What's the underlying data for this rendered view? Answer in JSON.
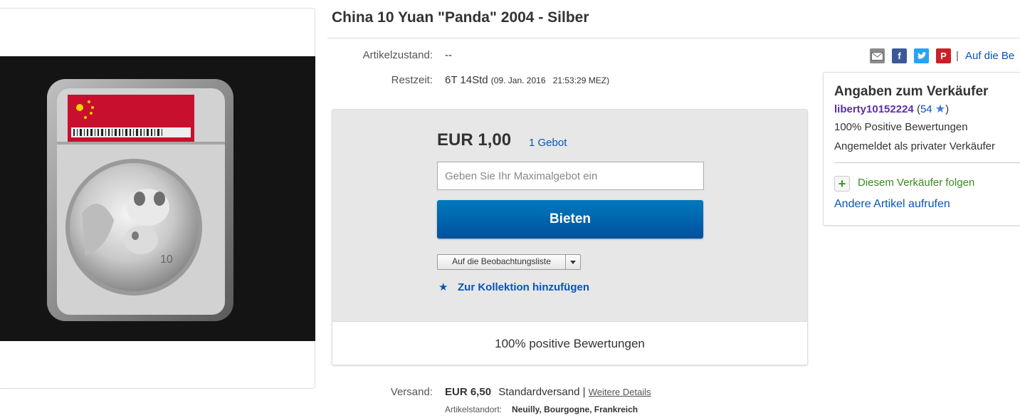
{
  "listing": {
    "title": "China 10 Yuan \"Panda\" 2004 - Silber",
    "condition_label": "Artikelzustand:",
    "condition_value": "--",
    "time_label": "Restzeit:",
    "time_value": "6T 14Std",
    "end_date": "(09. Jan. 2016",
    "end_time": "21:53:29 MEZ)"
  },
  "share": {
    "email_icon": "email-icon",
    "facebook_icon": "facebook-icon",
    "twitter_icon": "twitter-icon",
    "pinterest_icon": "pinterest-icon",
    "separator": "|",
    "watch_link": "Auf die Be"
  },
  "bid": {
    "price": "EUR 1,00",
    "bid_count": "1 Gebot",
    "max_bid_placeholder": "Geben Sie Ihr Maximalgebot ein",
    "bid_button": "Bieten",
    "watchlist": "Auf die Beobachtungsliste",
    "collection": "Zur Kollektion hinzufügen",
    "positive": "100% positive Bewertungen"
  },
  "seller": {
    "heading": "Angaben zum Verkäufer",
    "username": "liberty10152224",
    "open_paren": "(",
    "score": "54",
    "close_paren": ")",
    "positive": "100% Positive Bewertungen",
    "type": "Angemeldet als privater Verkäufer",
    "follow": "Diesem Verkäufer folgen",
    "other_items": "Andere Artikel aufrufen"
  },
  "shipping": {
    "label": "Versand:",
    "cost": "EUR 6,50",
    "method": "Standardversand",
    "separator": "|",
    "details_link": "Weitere Details",
    "location_label": "Artikelstandort:",
    "location_value": "Neuilly, Bourgogne, Frankreich"
  },
  "colors": {
    "link": "#0654ba",
    "bid_button": "#0079bc",
    "seller_name": "#5c2fa8",
    "follow_green": "#3a8a1f"
  }
}
